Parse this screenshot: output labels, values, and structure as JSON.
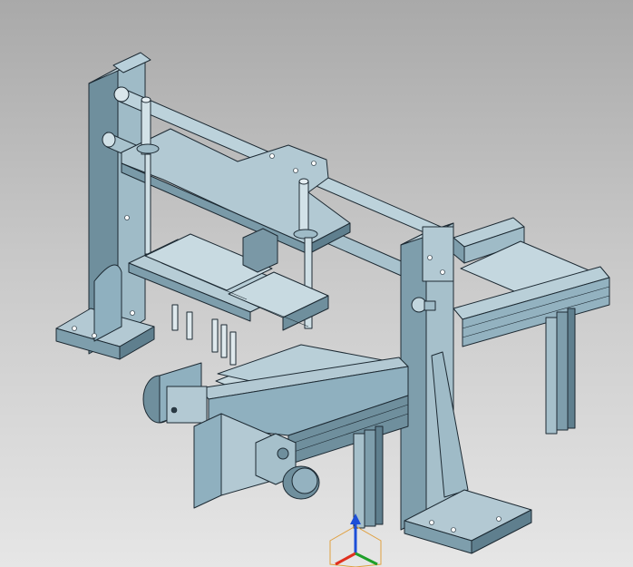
{
  "viewport": {
    "background_top": "#a9a9a9",
    "background_bottom": "#e6e6e6",
    "part_color_light": "#b4ccd6",
    "part_color_mid": "#8fb0bf",
    "part_color_dark": "#5f7f8e",
    "edge_color": "#1d2a33"
  },
  "axis_triad": {
    "x_color": "#e0301e",
    "y_color": "#1fa02a",
    "z_color": "#1d4fd8",
    "cube_color": "#e0a040"
  }
}
